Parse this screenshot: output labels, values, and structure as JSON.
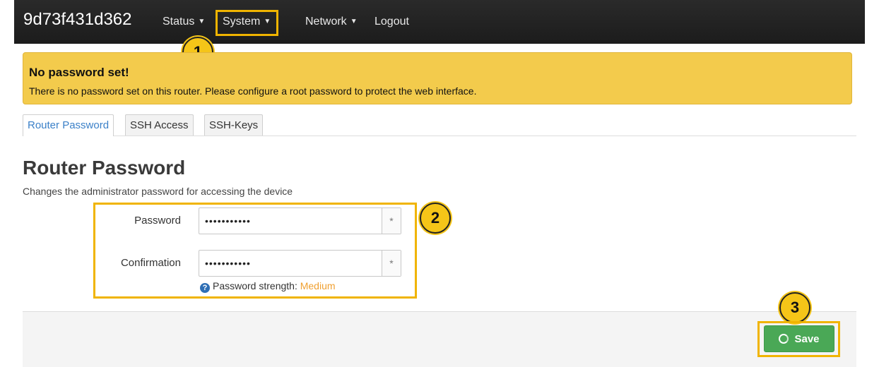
{
  "navbar": {
    "brand": "9d73f431d362",
    "items": [
      {
        "label": "Status",
        "has_dropdown": true
      },
      {
        "label": "System",
        "has_dropdown": true,
        "highlighted": true
      },
      {
        "label": "Network",
        "has_dropdown": true
      },
      {
        "label": "Logout",
        "has_dropdown": false
      }
    ]
  },
  "alert": {
    "title": "No password set!",
    "text": "There is no password set on this router. Please configure a root password to protect the web interface."
  },
  "tabs": [
    {
      "label": "Router Password",
      "active": true
    },
    {
      "label": "SSH Access",
      "active": false
    },
    {
      "label": "SSH-Keys",
      "active": false
    }
  ],
  "section": {
    "title": "Router Password",
    "description": "Changes the administrator password for accessing the device"
  },
  "form": {
    "password": {
      "label": "Password",
      "value": "•••••••••••",
      "reveal_symbol": "*"
    },
    "confirmation": {
      "label": "Confirmation",
      "value": "•••••••••••",
      "reveal_symbol": "*"
    },
    "strength_label": "Password strength: ",
    "strength_value": "Medium",
    "help_symbol": "?"
  },
  "footer": {
    "save_label": "Save"
  },
  "annotations": {
    "step1": "1",
    "step2": "2",
    "step3": "3"
  },
  "colors": {
    "alert_bg": "#f3cb4c",
    "highlight": "#f0b400",
    "save_bg": "#4aa856",
    "active_tab_text": "#3b80c8",
    "strength_medium": "#f0a030"
  }
}
